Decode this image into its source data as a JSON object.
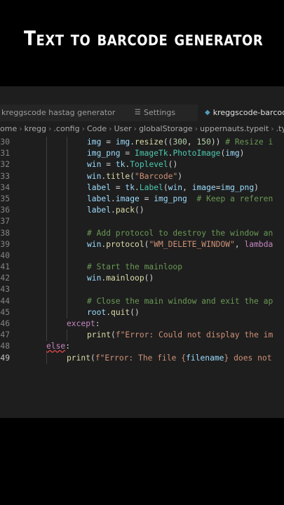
{
  "video_title": "Text to barcode generator",
  "tabs": [
    {
      "label": "kreggscode hastag generator",
      "icon": "",
      "active": false
    },
    {
      "label": "Settings",
      "icon": "settings-icon",
      "active": false
    },
    {
      "label": "kreggscode-barcode",
      "icon": "python-icon",
      "active": true
    }
  ],
  "breadcrumb": [
    "ome",
    "kregg",
    ".config",
    "Code",
    "User",
    "globalStorage",
    "uppernauts.typeit",
    ".typ"
  ],
  "code_lines": [
    {
      "num": "30",
      "tokens": [
        [
          "var",
          "img"
        ],
        [
          "p",
          " = "
        ],
        [
          "var",
          "img"
        ],
        [
          "p",
          "."
        ],
        [
          "fn",
          "resize"
        ],
        [
          "p",
          "(("
        ],
        [
          "num",
          "300"
        ],
        [
          "p",
          ", "
        ],
        [
          "num",
          "150"
        ],
        [
          "p",
          ")) "
        ],
        [
          "cm",
          "# Resize i"
        ]
      ]
    },
    {
      "num": "31",
      "tokens": [
        [
          "var",
          "img_png"
        ],
        [
          "p",
          " = "
        ],
        [
          "cls",
          "ImageTk"
        ],
        [
          "p",
          "."
        ],
        [
          "cls",
          "PhotoImage"
        ],
        [
          "p",
          "("
        ],
        [
          "var",
          "img"
        ],
        [
          "p",
          ")"
        ]
      ]
    },
    {
      "num": "32",
      "tokens": [
        [
          "var",
          "win"
        ],
        [
          "p",
          " = "
        ],
        [
          "var",
          "tk"
        ],
        [
          "p",
          "."
        ],
        [
          "cls",
          "Toplevel"
        ],
        [
          "p",
          "()"
        ]
      ]
    },
    {
      "num": "33",
      "tokens": [
        [
          "var",
          "win"
        ],
        [
          "p",
          "."
        ],
        [
          "fn",
          "title"
        ],
        [
          "p",
          "("
        ],
        [
          "str",
          "\"Barcode\""
        ],
        [
          "p",
          ")"
        ]
      ]
    },
    {
      "num": "34",
      "tokens": [
        [
          "var",
          "label"
        ],
        [
          "p",
          " = "
        ],
        [
          "var",
          "tk"
        ],
        [
          "p",
          "."
        ],
        [
          "cls",
          "Label"
        ],
        [
          "p",
          "("
        ],
        [
          "var",
          "win"
        ],
        [
          "p",
          ", "
        ],
        [
          "var",
          "image"
        ],
        [
          "p",
          "="
        ],
        [
          "var",
          "img_png"
        ],
        [
          "p",
          ")"
        ]
      ]
    },
    {
      "num": "35",
      "tokens": [
        [
          "var",
          "label"
        ],
        [
          "p",
          "."
        ],
        [
          "var",
          "image"
        ],
        [
          "p",
          " = "
        ],
        [
          "var",
          "img_png"
        ],
        [
          "p",
          "  "
        ],
        [
          "cm",
          "# Keep a referen"
        ]
      ]
    },
    {
      "num": "36",
      "tokens": [
        [
          "var",
          "label"
        ],
        [
          "p",
          "."
        ],
        [
          "fn",
          "pack"
        ],
        [
          "p",
          "()"
        ]
      ]
    },
    {
      "num": "37",
      "tokens": []
    },
    {
      "num": "38",
      "tokens": [
        [
          "cm",
          "# Add protocol to destroy the window an"
        ]
      ]
    },
    {
      "num": "39",
      "tokens": [
        [
          "var",
          "win"
        ],
        [
          "p",
          "."
        ],
        [
          "fn",
          "protocol"
        ],
        [
          "p",
          "("
        ],
        [
          "str",
          "\"WM_DELETE_WINDOW\""
        ],
        [
          "p",
          ", "
        ],
        [
          "kw",
          "lambda"
        ]
      ]
    },
    {
      "num": "40",
      "tokens": []
    },
    {
      "num": "41",
      "tokens": [
        [
          "cm",
          "# Start the mainloop"
        ]
      ]
    },
    {
      "num": "42",
      "tokens": [
        [
          "var",
          "win"
        ],
        [
          "p",
          "."
        ],
        [
          "fn",
          "mainloop"
        ],
        [
          "p",
          "()"
        ]
      ]
    },
    {
      "num": "43",
      "tokens": []
    },
    {
      "num": "44",
      "tokens": [
        [
          "cm",
          "# Close the main window and exit the ap"
        ]
      ]
    },
    {
      "num": "45",
      "tokens": [
        [
          "var",
          "root"
        ],
        [
          "p",
          "."
        ],
        [
          "fn",
          "quit"
        ],
        [
          "p",
          "()"
        ]
      ]
    },
    {
      "num": "46",
      "tokens": [
        [
          "ctl",
          "except"
        ],
        [
          "p",
          ":"
        ]
      ]
    },
    {
      "num": "47",
      "tokens": [
        [
          "fn",
          "print"
        ],
        [
          "p",
          "("
        ],
        [
          "str",
          "f\"Error: Could not display the im"
        ]
      ]
    },
    {
      "num": "48",
      "tokens": [
        [
          "ctl",
          "else"
        ],
        [
          "p",
          ":"
        ]
      ]
    },
    {
      "num": "49",
      "tokens": [
        [
          "fn",
          "print"
        ],
        [
          "p",
          "("
        ],
        [
          "str",
          "f\"Error: The file {"
        ],
        [
          "var",
          "filename"
        ],
        [
          "str",
          "} does not"
        ]
      ]
    }
  ],
  "colors": {
    "background": "#000000",
    "editor_bg": "#1e1e1e",
    "tabbar_bg": "#252526",
    "python_icon": "#519aba"
  }
}
